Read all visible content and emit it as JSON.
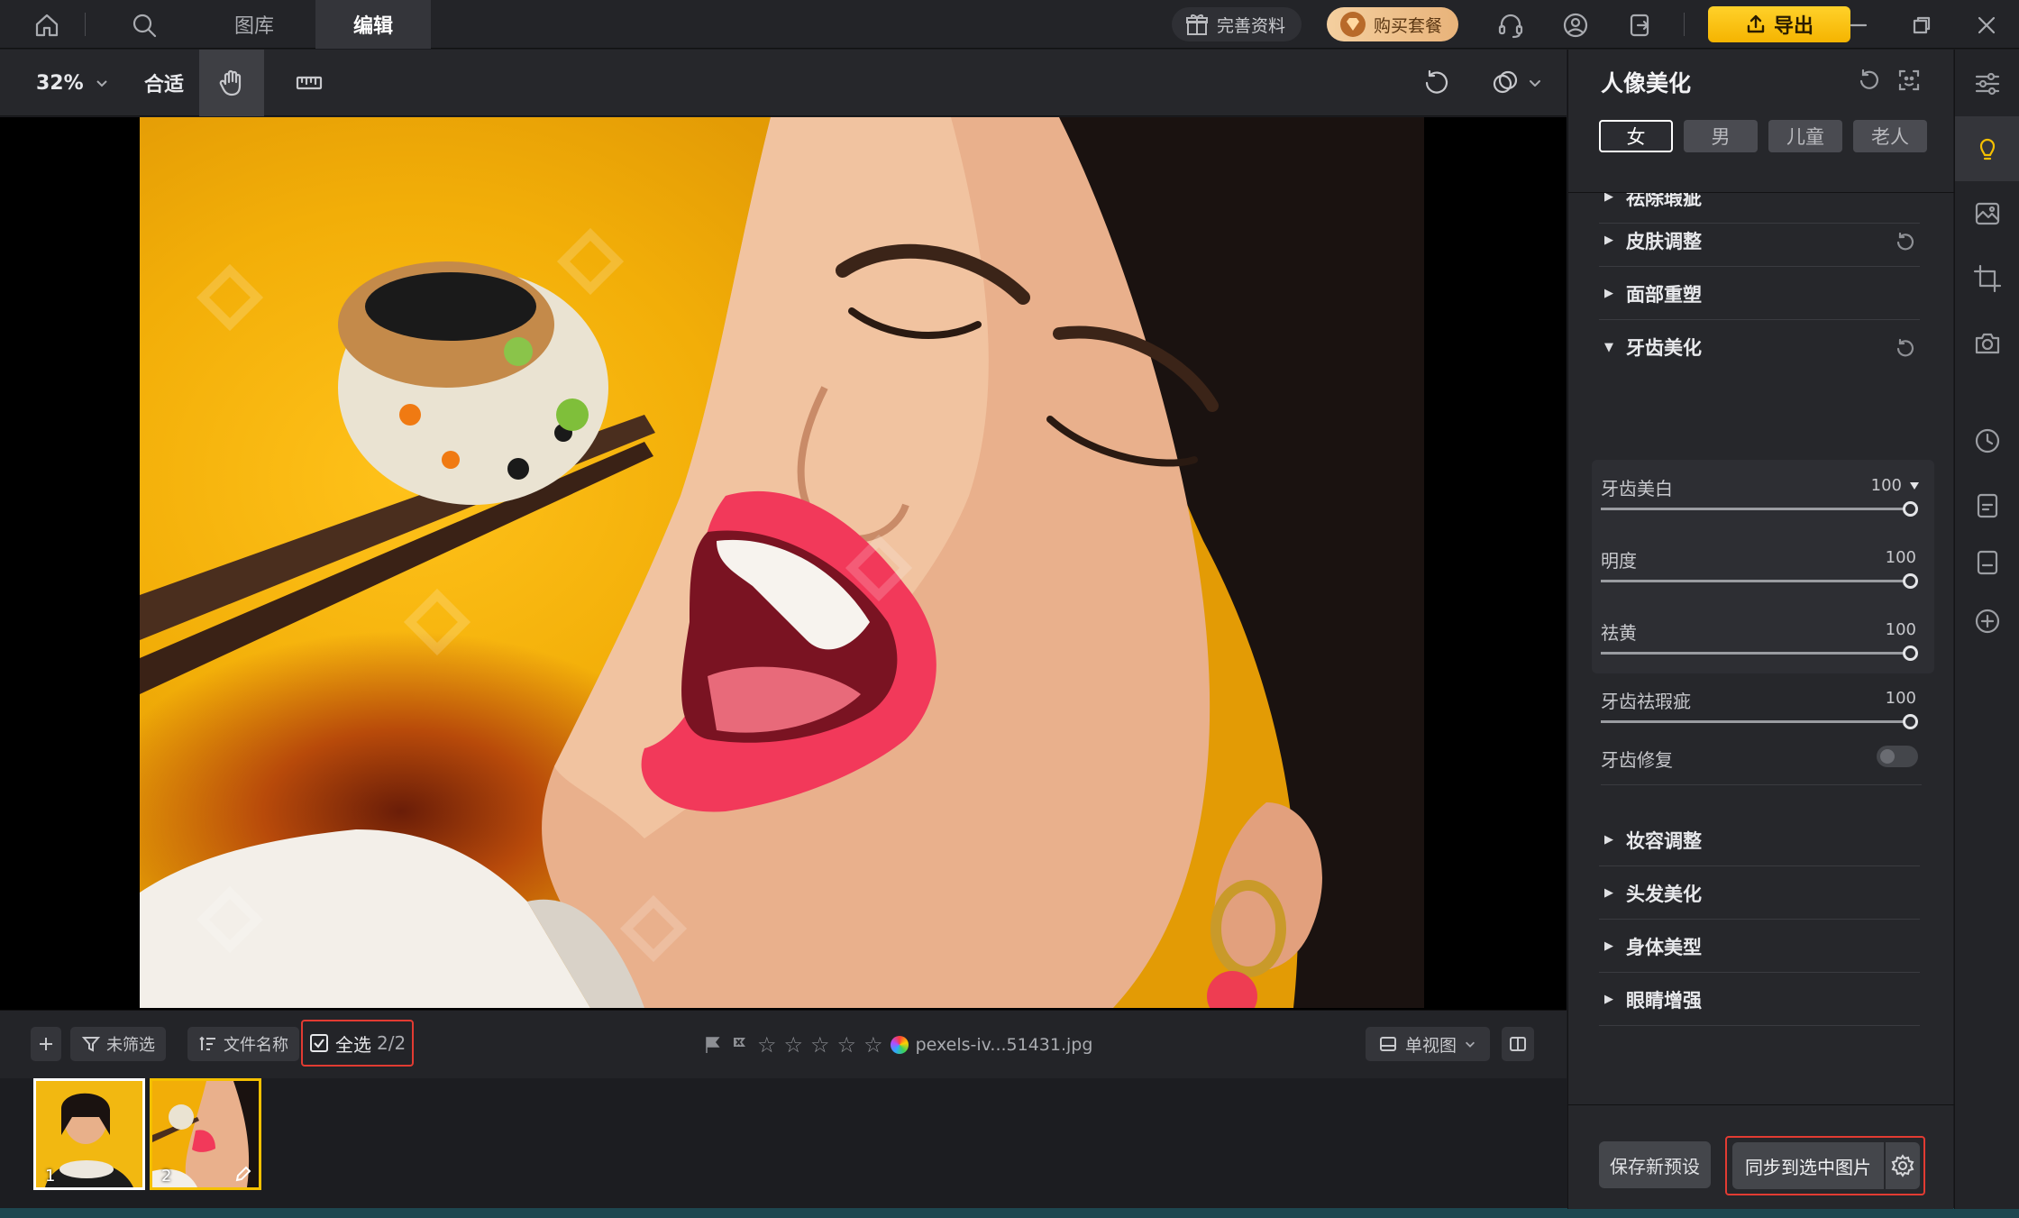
{
  "topbar": {
    "tabs": [
      {
        "label": "图库"
      },
      {
        "label": "编辑"
      }
    ],
    "profile_pill": "完善资料",
    "buy_pill": "购买套餐",
    "export_label": "导出"
  },
  "toolbar": {
    "zoom": "32%",
    "fit": "合适"
  },
  "canvas": {
    "image_subject": "woman eating sushi with chopsticks, yellow background"
  },
  "bottombar": {
    "filter_label": "未筛选",
    "sort_label": "文件名称",
    "select_all_label": "全选",
    "select_count": "2/2",
    "rating": 0,
    "filename": "pexels-iv...51431.jpg",
    "view_label": "单视图"
  },
  "filmstrip": {
    "thumbs": [
      {
        "num": "1",
        "selected": false
      },
      {
        "num": "2",
        "selected": true
      }
    ]
  },
  "panel": {
    "title": "人像美化",
    "genders": [
      "女",
      "男",
      "儿童",
      "老人"
    ],
    "active_gender": "女",
    "sections_top": [
      {
        "label": "祛除瑕疵"
      },
      {
        "label": "皮肤调整"
      },
      {
        "label": "面部重塑"
      },
      {
        "label": "牙齿美化"
      }
    ],
    "teeth": {
      "whiten_label": "牙齿美白",
      "whiten_value": "100",
      "brightness_label": "明度",
      "brightness_value": "100",
      "deyellow_label": "祛黄",
      "deyellow_value": "100",
      "blemish_label": "牙齿祛瑕疵",
      "blemish_value": "100",
      "repair_label": "牙齿修复"
    },
    "sections_bottom": [
      {
        "label": "妆容调整"
      },
      {
        "label": "头发美化"
      },
      {
        "label": "身体美型"
      },
      {
        "label": "眼睛增强"
      }
    ],
    "save_preset_label": "保存新预设",
    "sync_label": "同步到选中图片"
  },
  "colors": {
    "accent": "#f5c000",
    "highlight_border": "#e23b32",
    "panel_bg": "#26272b"
  }
}
